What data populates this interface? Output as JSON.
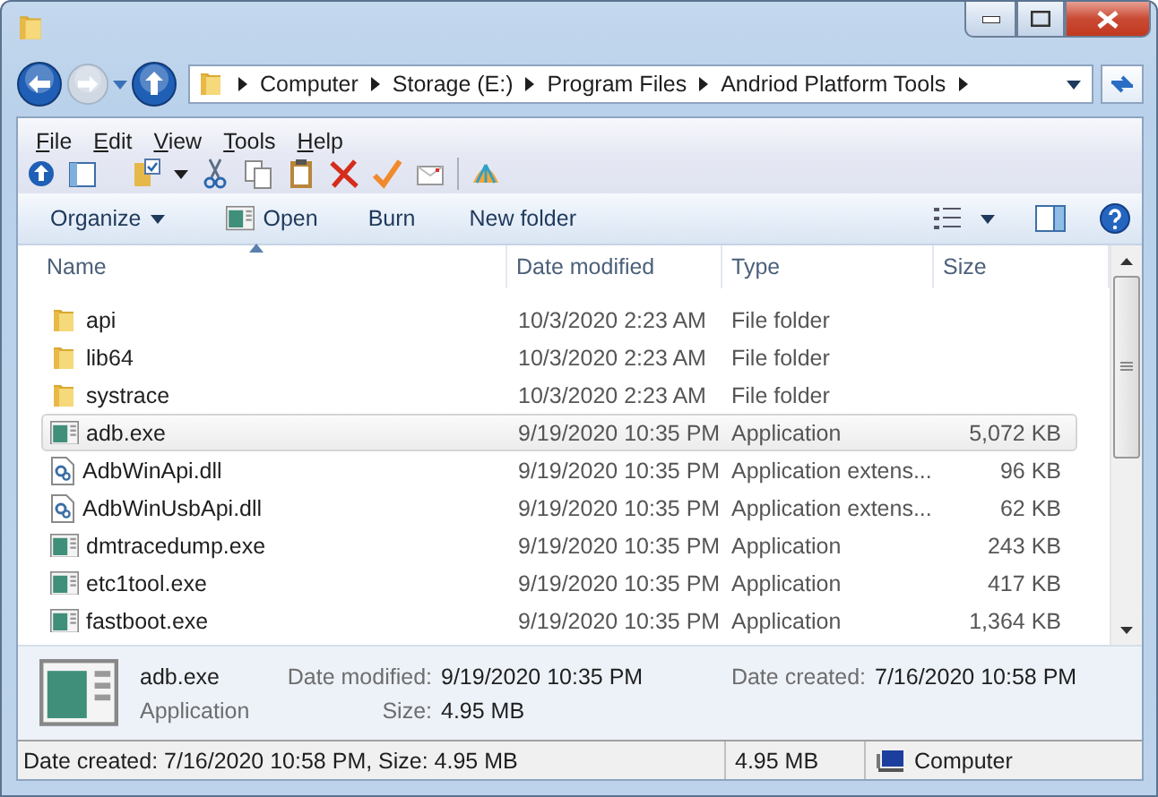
{
  "address": {
    "segments": [
      "Computer",
      "Storage (E:)",
      "Program Files",
      "Andriod Platform Tools"
    ]
  },
  "menu": [
    "File",
    "Edit",
    "View",
    "Tools",
    "Help"
  ],
  "commands": [
    {
      "label": "Organize",
      "kind": "dropdown"
    },
    {
      "label": "Open",
      "kind": "icon"
    },
    {
      "label": "Burn",
      "kind": "plain"
    },
    {
      "label": "New folder",
      "kind": "plain"
    }
  ],
  "columns": [
    "Name",
    "Date modified",
    "Type",
    "Size"
  ],
  "rows": [
    {
      "kind": "folder",
      "name": "api",
      "date": "10/3/2020 2:23 AM",
      "type": "File folder",
      "selected": false
    },
    {
      "kind": "folder",
      "name": "lib64",
      "date": "10/3/2020 2:23 AM",
      "type": "File folder",
      "selected": false
    },
    {
      "kind": "folder",
      "name": "systrace",
      "date": "10/3/2020 2:23 AM",
      "type": "File folder",
      "selected": false
    },
    {
      "kind": "app",
      "name": "adb.exe",
      "date": "9/19/2020 10:35 PM",
      "type": "Application",
      "size": "5,072 KB",
      "selected": true
    },
    {
      "kind": "dll",
      "name": "AdbWinApi.dll",
      "date": "9/19/2020 10:35 PM",
      "type": "Application extens...",
      "size": "96 KB",
      "selected": false
    },
    {
      "kind": "dll",
      "name": "AdbWinUsbApi.dll",
      "date": "9/19/2020 10:35 PM",
      "type": "Application extens...",
      "size": "62 KB",
      "selected": false
    },
    {
      "kind": "app",
      "name": "dmtracedump.exe",
      "date": "9/19/2020 10:35 PM",
      "type": "Application",
      "size": "243 KB",
      "selected": false
    },
    {
      "kind": "app",
      "name": "etc1tool.exe",
      "date": "9/19/2020 10:35 PM",
      "type": "Application",
      "size": "417 KB",
      "selected": false
    },
    {
      "kind": "app",
      "name": "fastboot.exe",
      "date": "9/19/2020 10:35 PM",
      "type": "Application",
      "size": "1,364 KB",
      "selected": false
    }
  ],
  "details": {
    "name": "adb.exe",
    "type": "Application",
    "fields": [
      {
        "label": "Date modified:",
        "value": "9/19/2020 10:35 PM"
      },
      {
        "label": "Size:",
        "value": "4.95 MB"
      },
      {
        "label": "Date created:",
        "value": "7/16/2020 10:58 PM"
      }
    ]
  },
  "status": {
    "text": "Date created: 7/16/2020 10:58 PM, Size: 4.95 MB",
    "size": "4.95 MB",
    "location": "Computer"
  }
}
